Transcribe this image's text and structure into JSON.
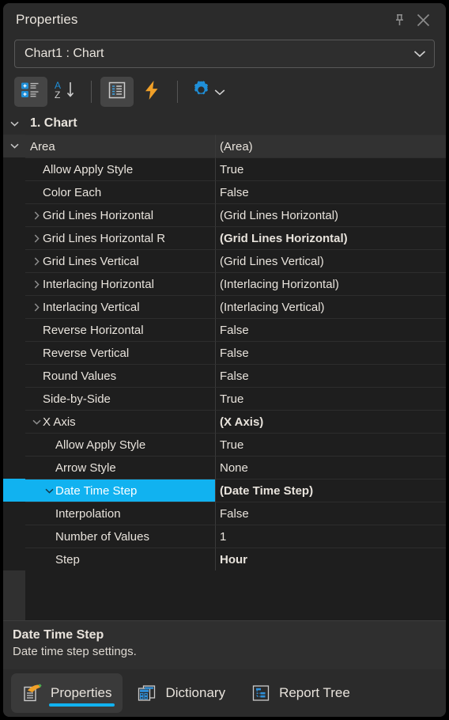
{
  "window": {
    "title": "Properties",
    "pin_icon": "pin-icon",
    "close_icon": "close-icon"
  },
  "object_selector": {
    "value": "Chart1 : Chart",
    "arrow_icon": "chevron-down-icon"
  },
  "toolbar": {
    "items": [
      {
        "name": "categorized-view-button",
        "icon": "categorized-icon",
        "active": true
      },
      {
        "name": "alphabetical-sort-button",
        "icon": "sort-az-icon",
        "active": false
      },
      {
        "name": "properties-view-button",
        "icon": "properties-list-icon",
        "active": true
      },
      {
        "name": "events-button",
        "icon": "lightning-icon",
        "active": false
      },
      {
        "name": "options-button",
        "icon": "gear-icon",
        "active": false
      }
    ]
  },
  "grid": {
    "header": {
      "label": "1. Chart",
      "expander": "chevron-down-icon"
    },
    "rows": [
      {
        "name": "Area",
        "value": "(Area)",
        "depth": 0,
        "expander": "down",
        "bold": false,
        "selected": false
      },
      {
        "name": "Allow Apply Style",
        "value": "True",
        "depth": 1,
        "expander": "none",
        "bold": false,
        "selected": false
      },
      {
        "name": "Color Each",
        "value": "False",
        "depth": 1,
        "expander": "none",
        "bold": false,
        "selected": false
      },
      {
        "name": "Grid Lines Horizontal",
        "value": "(Grid Lines Horizontal)",
        "depth": 1,
        "expander": "right",
        "bold": false,
        "selected": false
      },
      {
        "name": "Grid Lines Horizontal R",
        "value": "(Grid Lines Horizontal)",
        "depth": 1,
        "expander": "right",
        "bold": true,
        "selected": false
      },
      {
        "name": "Grid Lines Vertical",
        "value": "(Grid Lines Vertical)",
        "depth": 1,
        "expander": "right",
        "bold": false,
        "selected": false
      },
      {
        "name": "Interlacing Horizontal",
        "value": "(Interlacing Horizontal)",
        "depth": 1,
        "expander": "right",
        "bold": false,
        "selected": false
      },
      {
        "name": "Interlacing Vertical",
        "value": "(Interlacing Vertical)",
        "depth": 1,
        "expander": "right",
        "bold": false,
        "selected": false
      },
      {
        "name": "Reverse Horizontal",
        "value": "False",
        "depth": 1,
        "expander": "none",
        "bold": false,
        "selected": false
      },
      {
        "name": "Reverse Vertical",
        "value": "False",
        "depth": 1,
        "expander": "none",
        "bold": false,
        "selected": false
      },
      {
        "name": "Round Values",
        "value": "False",
        "depth": 1,
        "expander": "none",
        "bold": false,
        "selected": false
      },
      {
        "name": "Side-by-Side",
        "value": "True",
        "depth": 1,
        "expander": "none",
        "bold": false,
        "selected": false
      },
      {
        "name": "X Axis",
        "value": "(X Axis)",
        "depth": 1,
        "expander": "down",
        "bold": true,
        "selected": false
      },
      {
        "name": "Allow Apply Style",
        "value": "True",
        "depth": 2,
        "expander": "none",
        "bold": false,
        "selected": false
      },
      {
        "name": "Arrow Style",
        "value": "None",
        "depth": 2,
        "expander": "none",
        "bold": false,
        "selected": false
      },
      {
        "name": "Date Time Step",
        "value": "(Date Time Step)",
        "depth": 2,
        "expander": "down",
        "bold": true,
        "selected": true
      },
      {
        "name": "Interpolation",
        "value": "False",
        "depth": 2,
        "expander": "none",
        "bold": false,
        "selected": false
      },
      {
        "name": "Number of Values",
        "value": "1",
        "depth": 2,
        "expander": "none",
        "bold": false,
        "selected": false
      },
      {
        "name": "Step",
        "value": "Hour",
        "depth": 2,
        "expander": "none",
        "bold": true,
        "selected": false
      }
    ]
  },
  "description": {
    "title": "Date Time Step",
    "text": "Date time step settings."
  },
  "tabs": [
    {
      "label": "Properties",
      "icon": "properties-pencil-icon",
      "active": true
    },
    {
      "label": "Dictionary",
      "icon": "dictionary-icon",
      "active": false
    },
    {
      "label": "Report Tree",
      "icon": "report-tree-icon",
      "active": false
    }
  ],
  "colors": {
    "accent": "#11b2f0",
    "panel_bg": "#2b2b2b",
    "grid_bg": "#1e1e1e",
    "text": "#e8e3dc",
    "lightning": "#f0a028"
  }
}
